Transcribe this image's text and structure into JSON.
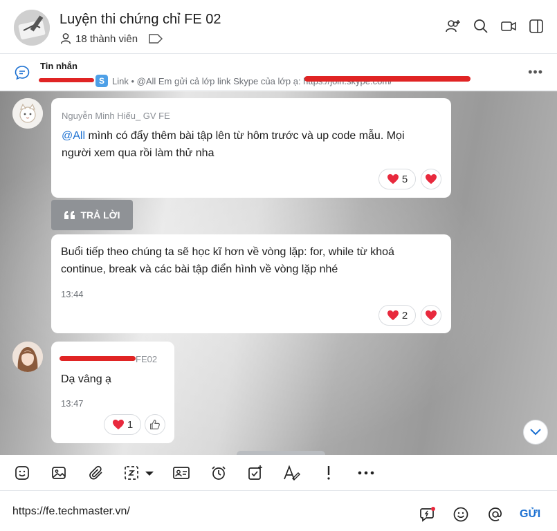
{
  "header": {
    "group_name": "Luyện thi chứng chỉ FE 02",
    "member_count": "18 thành viên"
  },
  "pinned": {
    "title": "Tin nhắn",
    "preview": "Link • @All Em gửi cả lớp link Skype của lớp ạ: https://join.skype.com/"
  },
  "messages": [
    {
      "sender": "Nguyễn Minh Hiếu_ GV FE",
      "mention": "@All",
      "text_line1": " mình có đẩy thêm bài tập lên từ hôm trước và up code mẫu. Mọi",
      "text_line2": "người xem qua rồi làm thử nha",
      "reaction_count": "5"
    },
    {
      "text_line1": "Buổi tiếp theo chúng ta sẽ học kĩ hơn về vòng lặp: for, while từ khoá",
      "text_line2": "continue, break và các bài tập điển hình về vòng lặp nhé",
      "time": "13:44",
      "reaction_count": "2"
    },
    {
      "sender_suffix": "FE02",
      "text": "Dạ vâng ạ",
      "time": "13:47",
      "reaction_count": "1"
    }
  ],
  "reply_label": "TRẢ LỜI",
  "composer": {
    "value": "https://fe.techmaster.vn/",
    "send_label": "GỬI"
  },
  "colors": {
    "accent": "#1a6fd1",
    "heart": "#e8293d",
    "redaction": "#e02424"
  }
}
